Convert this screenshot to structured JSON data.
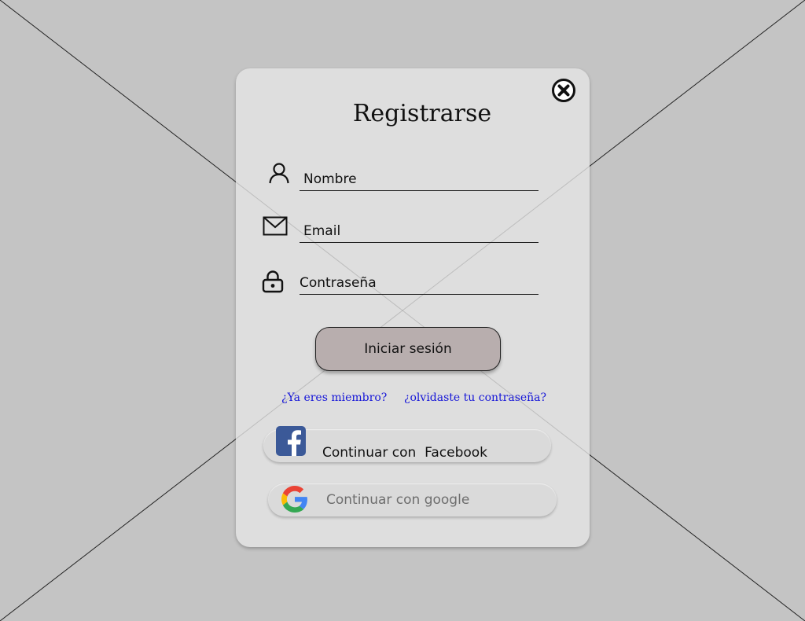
{
  "dialog": {
    "title": "Registrarse",
    "fields": {
      "name_placeholder": "Nombre",
      "email_placeholder": "Email",
      "password_placeholder": "Contraseña"
    },
    "login_button": "Iniciar sesión",
    "links": {
      "member": "¿Ya eres miembro?",
      "forgot": "¿olvidaste tu contraseña?"
    },
    "social": {
      "facebook_label": "Continuar con  Facebook",
      "google_label": "Continuar con google"
    }
  },
  "icons": {
    "close": "close-circle-icon",
    "name": "user-icon",
    "email": "envelope-icon",
    "password": "lock-icon",
    "facebook": "facebook-logo-icon",
    "google": "google-logo-icon"
  },
  "colors": {
    "background": "#c4c4c4",
    "card": "#dedede",
    "login_button": "#b8aeae",
    "link": "#1616d8",
    "facebook": "#3b5998"
  }
}
